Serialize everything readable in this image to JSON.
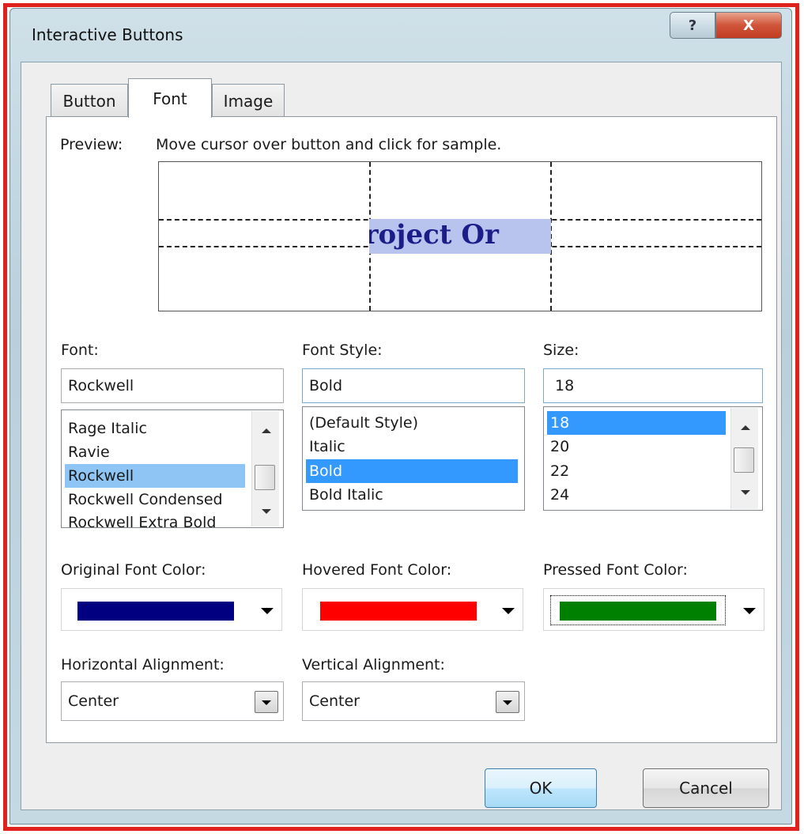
{
  "window": {
    "title": "Interactive Buttons",
    "help_glyph": "?",
    "close_glyph": "X"
  },
  "tabs": [
    {
      "label": "Button"
    },
    {
      "label": "Font"
    },
    {
      "label": "Image"
    }
  ],
  "active_tab": "Font",
  "preview": {
    "label": "Preview:",
    "hint": "Move cursor over button and click for sample.",
    "sample_text": "Project Or"
  },
  "font": {
    "label": "Font:",
    "value": "Rockwell",
    "items": [
      "Rage Italic",
      "Ravie",
      "Rockwell",
      "Rockwell Condensed",
      "Rockwell Extra Bold"
    ],
    "selected": "Rockwell"
  },
  "font_style": {
    "label": "Font Style:",
    "value": "Bold",
    "items": [
      "(Default Style)",
      "Italic",
      "Bold",
      "Bold Italic"
    ],
    "selected": "Bold"
  },
  "size": {
    "label": "Size:",
    "value": "18",
    "items": [
      "18",
      "20",
      "22",
      "24"
    ],
    "selected": "18"
  },
  "colors": {
    "original": {
      "label": "Original Font Color:",
      "color": "#000080"
    },
    "hovered": {
      "label": "Hovered Font Color:",
      "color": "#ff0000"
    },
    "pressed": {
      "label": "Pressed Font Color:",
      "color": "#008000"
    }
  },
  "alignment": {
    "horizontal": {
      "label": "Horizontal Alignment:",
      "value": "Center"
    },
    "vertical": {
      "label": "Vertical Alignment:",
      "value": "Center"
    }
  },
  "buttons": {
    "ok": "OK",
    "cancel": "Cancel"
  }
}
